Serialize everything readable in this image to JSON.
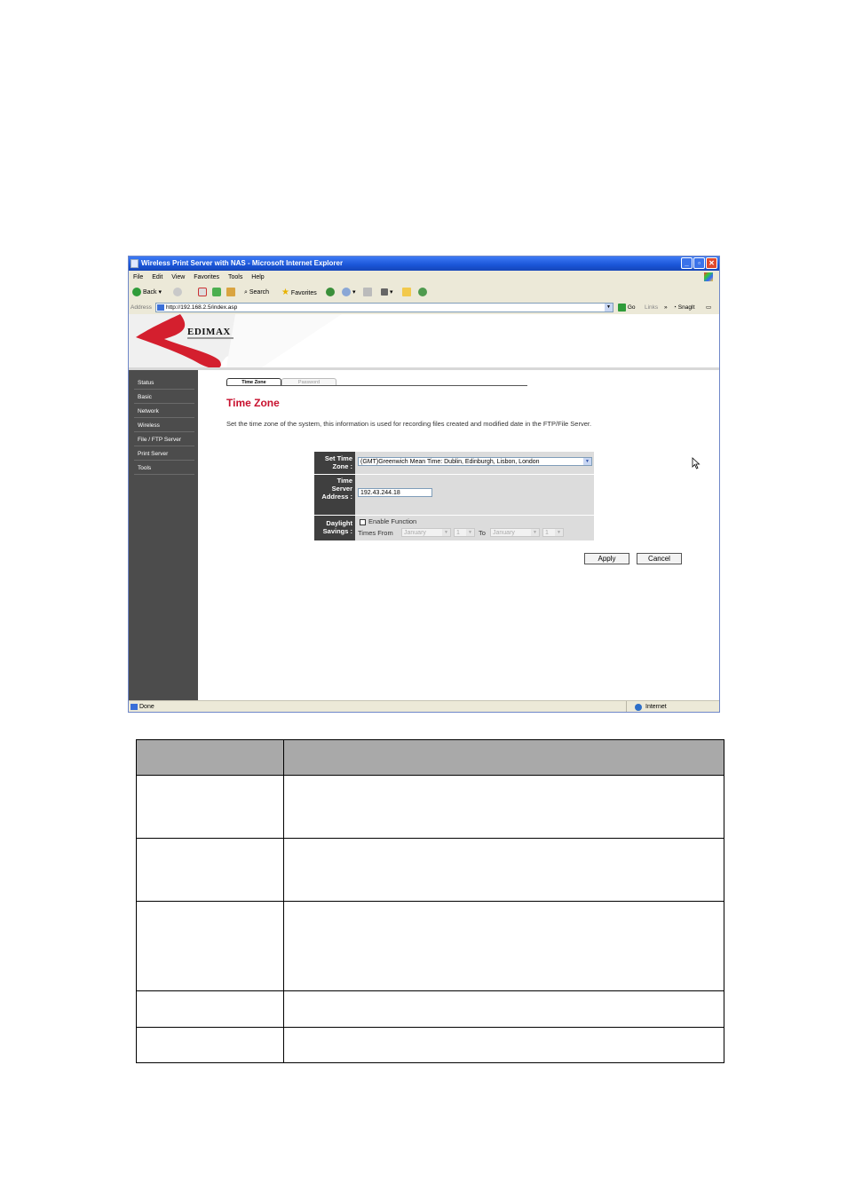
{
  "window": {
    "title": "Wireless Print Server with NAS - Microsoft Internet Explorer",
    "menu": [
      "File",
      "Edit",
      "View",
      "Favorites",
      "Tools",
      "Help"
    ],
    "toolbar": {
      "back": "Back",
      "search": "Search",
      "favorites": "Favorites"
    },
    "address_label": "Address",
    "address": "http://192.168.2.5/index.asp",
    "go": "Go",
    "links": "Links",
    "snagit": "SnagIt"
  },
  "brand": {
    "logo": "EDIMAX"
  },
  "sidebar": {
    "items": [
      {
        "label": "Status"
      },
      {
        "label": "Basic"
      },
      {
        "label": "Network"
      },
      {
        "label": "Wireless"
      },
      {
        "label": "File / FTP Server"
      },
      {
        "label": "Print Server"
      },
      {
        "label": "Tools"
      }
    ]
  },
  "tabs": [
    {
      "label": "Time Zone",
      "active": true
    },
    {
      "label": "Password",
      "active": false
    }
  ],
  "page": {
    "title": "Time Zone",
    "description": "Set the time zone of the system, this information is used for recording files created and modified date in the FTP/File Server."
  },
  "form": {
    "set_time_zone": {
      "label_line1": "Set Time",
      "label_line2": "Zone :",
      "value": "(GMT)Greenwich Mean Time: Dublin, Edinburgh, Lisbon, London"
    },
    "time_server": {
      "label_line1": "Time",
      "label_line2": "Server",
      "label_line3": "Address :",
      "value": "192.43.244.18"
    },
    "daylight": {
      "label_line1": "Daylight",
      "label_line2": "Savings :",
      "enable_label": "Enable Function",
      "enabled": false,
      "times_from_label": "Times From",
      "from_month": "January",
      "from_day": "1",
      "to_label": "To",
      "to_month": "January",
      "to_day": "1"
    },
    "apply_label": "Apply",
    "cancel_label": "Cancel"
  },
  "status": {
    "left": "Done",
    "zone": "Internet"
  },
  "colors": {
    "title_red": "#c8102e",
    "sidebar": "#4c4c4c",
    "label_bg": "#3f3f3f",
    "titlebar": "#1a55d8"
  },
  "icons": [
    "back-icon",
    "forward-icon",
    "stop-icon",
    "refresh-icon",
    "home-icon",
    "search-icon",
    "favorites-star-icon",
    "media-icon",
    "mail-icon",
    "print-icon",
    "edit-icon",
    "folder-icon",
    "messenger-icon",
    "cursor-arrow-icon",
    "globe-icon"
  ]
}
